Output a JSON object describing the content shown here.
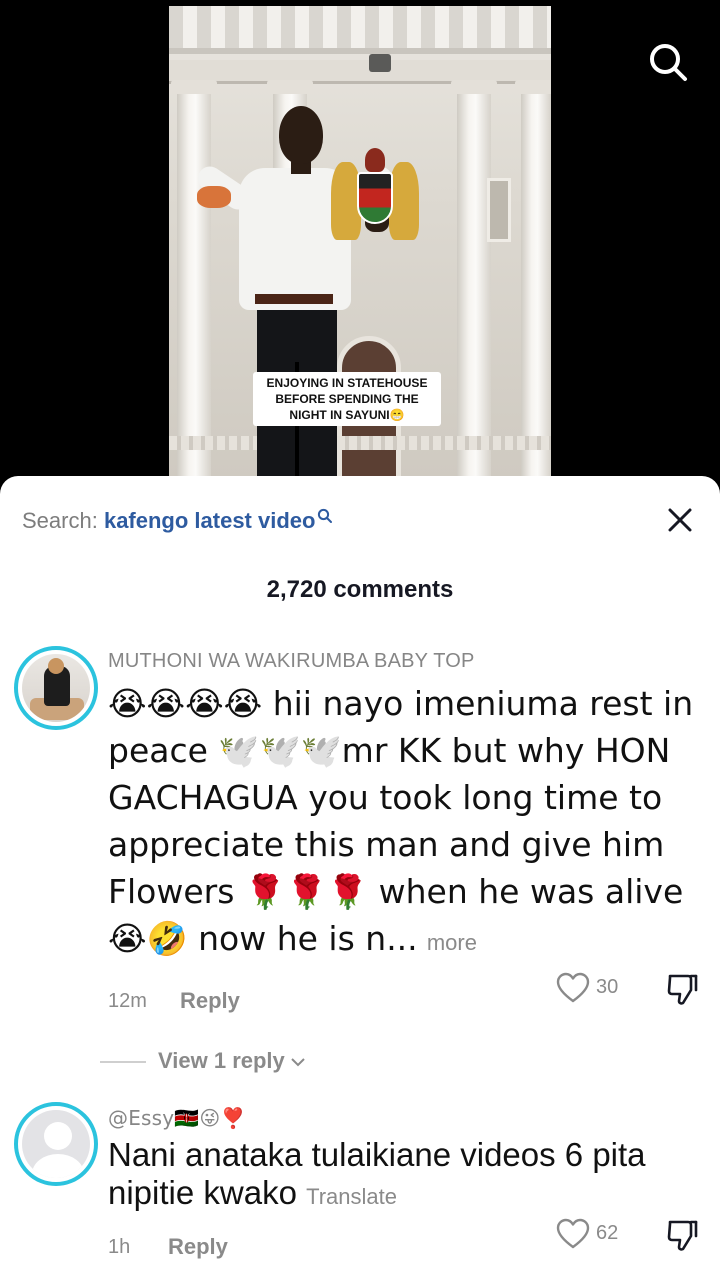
{
  "video": {
    "caption": "ENJOYING IN STATEHOUSE BEFORE SPENDING THE NIGHT IN SAYUNI😁"
  },
  "top_bar": {
    "search_icon": "search-icon"
  },
  "comments_sheet": {
    "search_prefix": "Search:",
    "search_term": "kafengo latest video",
    "close_icon": "close-icon",
    "comment_count": "2,720 comments",
    "accent_color": "#2bc3de",
    "comments": [
      {
        "username": "MUTHONI WA WAKIRUMBA BABY TOP",
        "text": "😭😭😭😭 hii nayo imeniuma rest in peace 🕊️🕊️🕊️mr KK but why HON GACHAGUA you took long time to appreciate this man and give him Flowers 🌹🌹🌹 when he was alive 😭🤣 now he is n...",
        "more_label": "more",
        "time": "12m",
        "reply_label": "Reply",
        "likes": "30",
        "view_replies": "View 1 reply"
      },
      {
        "username": "@Essy🇰🇪😜❣️",
        "text": "Nani anataka tulaikiane videos 6 pita nipitie kwako",
        "translate_label": "Translate",
        "time": "1h",
        "reply_label": "Reply",
        "likes": "62"
      }
    ]
  }
}
